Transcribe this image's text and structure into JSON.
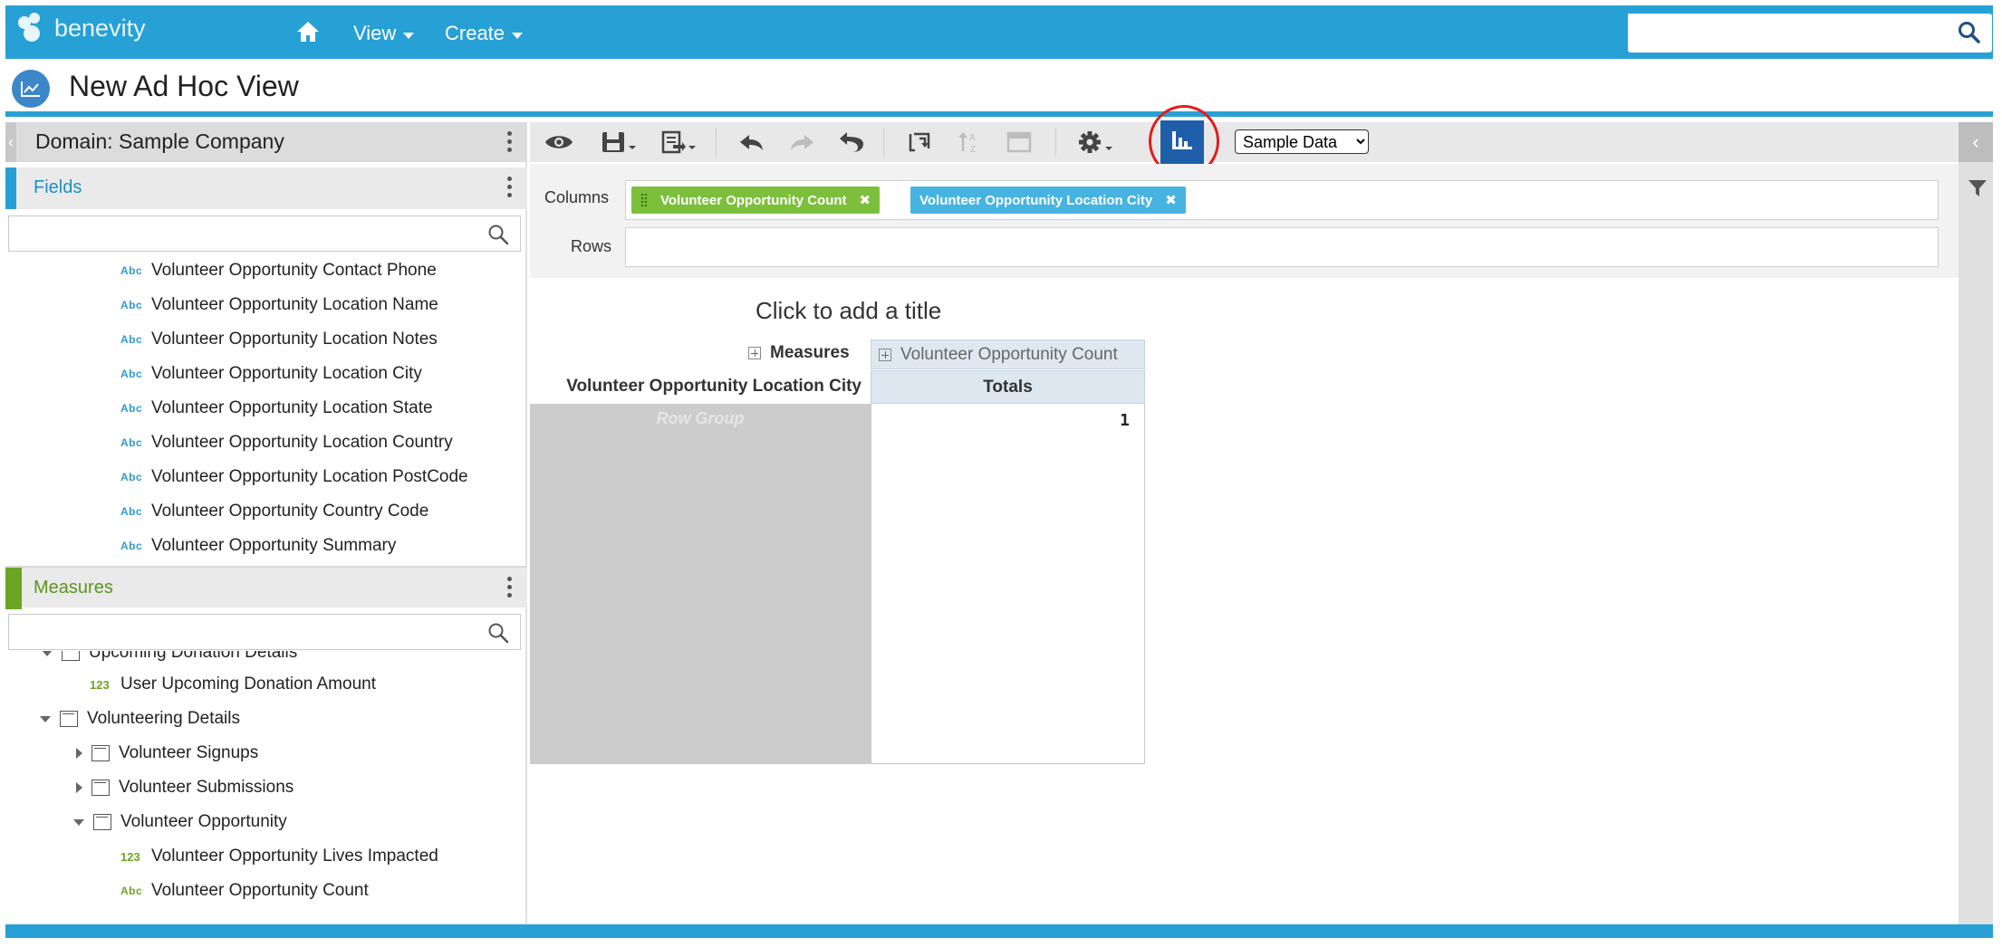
{
  "app": {
    "brand": "benevity",
    "nav": [
      {
        "label": "View"
      },
      {
        "label": "Create"
      }
    ],
    "search_value": ""
  },
  "page": {
    "title": "New Ad Hoc View"
  },
  "left_panel": {
    "domain_label": "Domain: Sample Company",
    "fields": {
      "label": "Fields",
      "accent": "#27a0d6",
      "search_value": "",
      "items": [
        {
          "type": "Abc",
          "label": "Volunteer Opportunity Contact Phone"
        },
        {
          "type": "Abc",
          "label": "Volunteer Opportunity Location Name"
        },
        {
          "type": "Abc",
          "label": "Volunteer Opportunity Location Notes"
        },
        {
          "type": "Abc",
          "label": "Volunteer Opportunity Location City"
        },
        {
          "type": "Abc",
          "label": "Volunteer Opportunity Location State"
        },
        {
          "type": "Abc",
          "label": "Volunteer Opportunity Location Country"
        },
        {
          "type": "Abc",
          "label": "Volunteer Opportunity Location PostCode"
        },
        {
          "type": "Abc",
          "label": "Volunteer Opportunity Country Code"
        },
        {
          "type": "Abc",
          "label": "Volunteer Opportunity Summary"
        }
      ]
    },
    "measures": {
      "label": "Measures",
      "accent": "#6aa624",
      "search_value": "",
      "partial_item": "Upcoming Donation Details",
      "items": [
        {
          "type": "123",
          "label": "User Upcoming Donation Amount"
        },
        {
          "type": "folder",
          "state": "expanded",
          "label": "Volunteering Details"
        },
        {
          "type": "folder",
          "state": "collapsed",
          "label": "Volunteer Signups"
        },
        {
          "type": "folder",
          "state": "collapsed",
          "label": "Volunteer Submissions"
        },
        {
          "type": "folder",
          "state": "expanded",
          "label": "Volunteer Opportunity"
        },
        {
          "type": "123",
          "label": "Volunteer Opportunity Lives Impacted"
        },
        {
          "type": "Abc",
          "label": "Volunteer Opportunity Count"
        }
      ]
    }
  },
  "toolbar": {
    "icons": [
      "eye-icon",
      "save-icon",
      "export-icon",
      "undo-icon",
      "redo-icon",
      "undo-all-icon",
      "pivot-icon",
      "sort-icon",
      "page-layout-icon",
      "gear-icon",
      "chart-icon"
    ],
    "data_select": {
      "selected": "Sample Data",
      "options": [
        "Sample Data"
      ]
    },
    "active_color": "#1f5fa9",
    "highlight_ring_color": "#e11c1c"
  },
  "layout_zone": {
    "columns_label": "Columns",
    "rows_label": "Rows",
    "columns": [
      {
        "label": "Volunteer Opportunity Count",
        "color": "#7cbf3b"
      },
      {
        "label": "Volunteer Opportunity Location City",
        "color": "#47b3e0"
      }
    ]
  },
  "report": {
    "title_placeholder": "Click to add a title",
    "measures_label": "Measures",
    "measure_column": "Volunteer Opportunity Count",
    "row_header": "Volunteer Opportunity Location City",
    "totals_label": "Totals",
    "row_group_placeholder": "Row Group",
    "total_value": "1"
  },
  "colors": {
    "brand": "#27a0d6"
  }
}
